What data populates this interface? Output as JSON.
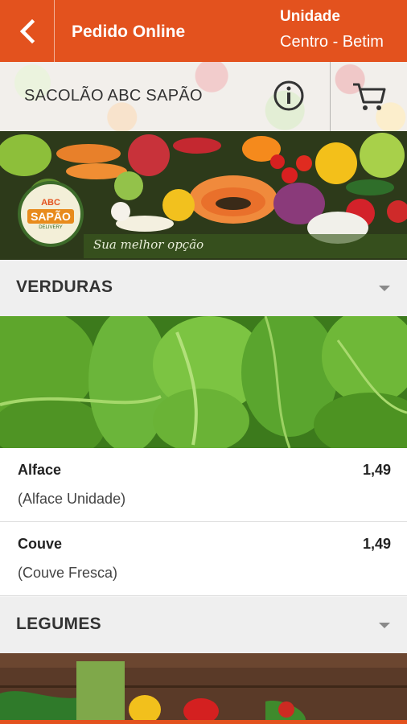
{
  "header": {
    "back_icon": "chevron-left-icon",
    "title": "Pedido Online",
    "unit_label": "Unidade",
    "unit_value": "Centro - Betim"
  },
  "store": {
    "name": "SACOLÃO ABC SAPÃO",
    "info_icon": "info-icon",
    "cart_icon": "cart-icon"
  },
  "banner": {
    "logo_small": "ABC",
    "logo_main": "SAPÃO",
    "logo_sub": "DELIVERY",
    "tagline": "Sua melhor opção"
  },
  "categories": [
    {
      "title": "VERDURAS",
      "products": [
        {
          "name": "Alface",
          "description": "(Alface Unidade)",
          "price": "1,49"
        },
        {
          "name": "Couve",
          "description": "(Couve Fresca)",
          "price": "1,49"
        }
      ]
    },
    {
      "title": "LEGUMES",
      "products": []
    }
  ],
  "colors": {
    "accent": "#e3521e",
    "header_bg": "#efefef"
  }
}
